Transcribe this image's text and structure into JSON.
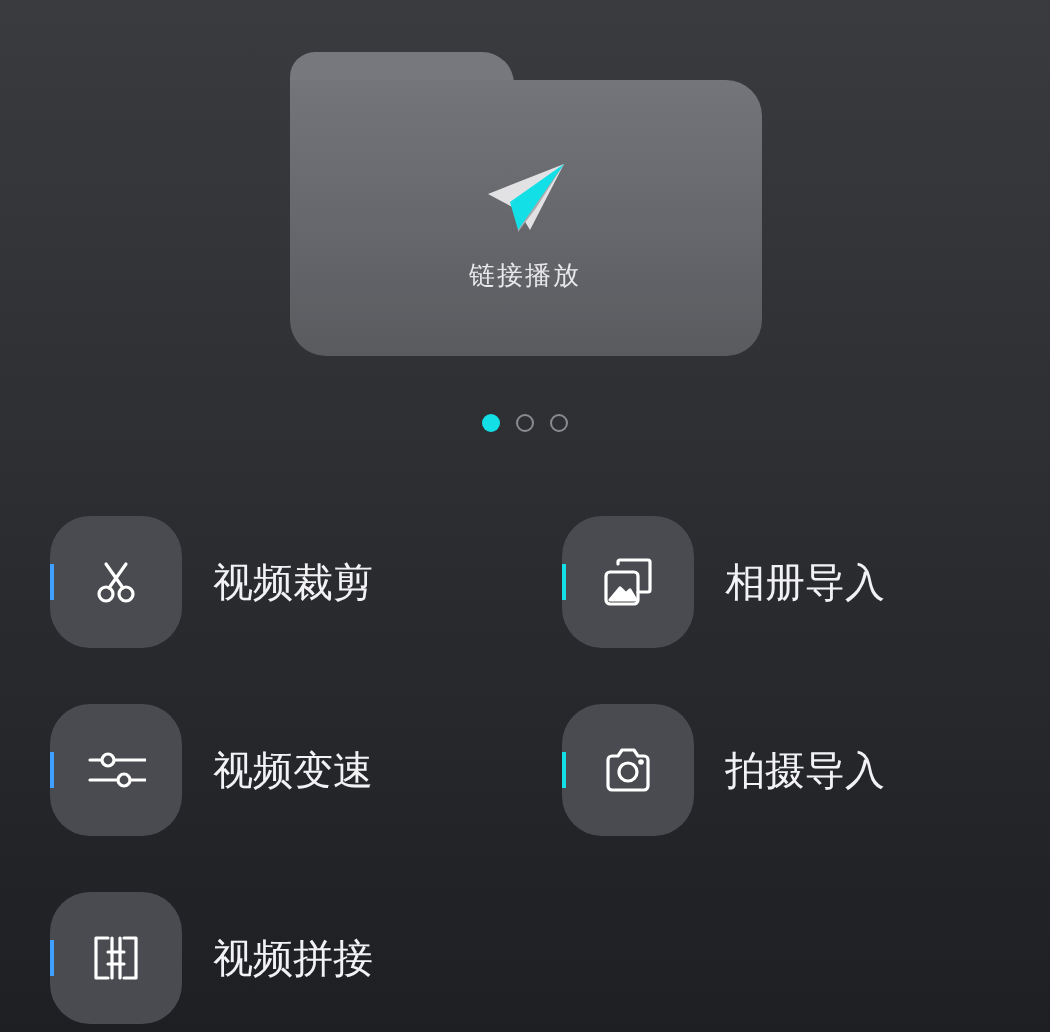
{
  "folder": {
    "label": "链接播放"
  },
  "pager": [
    {
      "selected": true
    },
    {
      "selected": false
    },
    {
      "selected": false
    }
  ],
  "tools": [
    {
      "label": "视频裁剪",
      "color": "#3fa0ff"
    },
    {
      "label": "相册导入",
      "color": "#12e0e6"
    },
    {
      "label": "视频变速",
      "color": "#3fa0ff"
    },
    {
      "label": "拍摄导入",
      "color": "#12e0e6"
    },
    {
      "label": "视频拼接",
      "color": "#3fa0ff"
    }
  ]
}
